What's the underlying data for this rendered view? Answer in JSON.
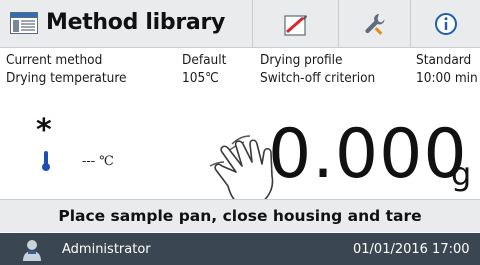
{
  "header": {
    "title": "Method library",
    "buttons": [
      {
        "name": "edit-icon"
      },
      {
        "name": "wrench-icon"
      },
      {
        "name": "info-icon"
      }
    ]
  },
  "method_info": {
    "current_method_label": "Current method",
    "current_method_value": "Default",
    "drying_profile_label": "Drying profile",
    "drying_profile_value": "Standard",
    "drying_temperature_label": "Drying temperature",
    "drying_temperature_value": "105℃",
    "switch_off_label": "Switch-off criterion",
    "switch_off_value": "10:00 min"
  },
  "display": {
    "stability_symbol": "*",
    "temperature_value": "--- ℃",
    "weight_value": "0.000",
    "weight_unit": "g"
  },
  "instruction": "Place sample pan, close housing and tare",
  "status_bar": {
    "user": "Administrator",
    "datetime": "01/01/2016 17:00"
  },
  "colors": {
    "header_bg": "#e9ebed",
    "status_bar_bg": "#3a4651",
    "thermometer": "#1f4fb5",
    "edit_accent": "#d9262c"
  }
}
